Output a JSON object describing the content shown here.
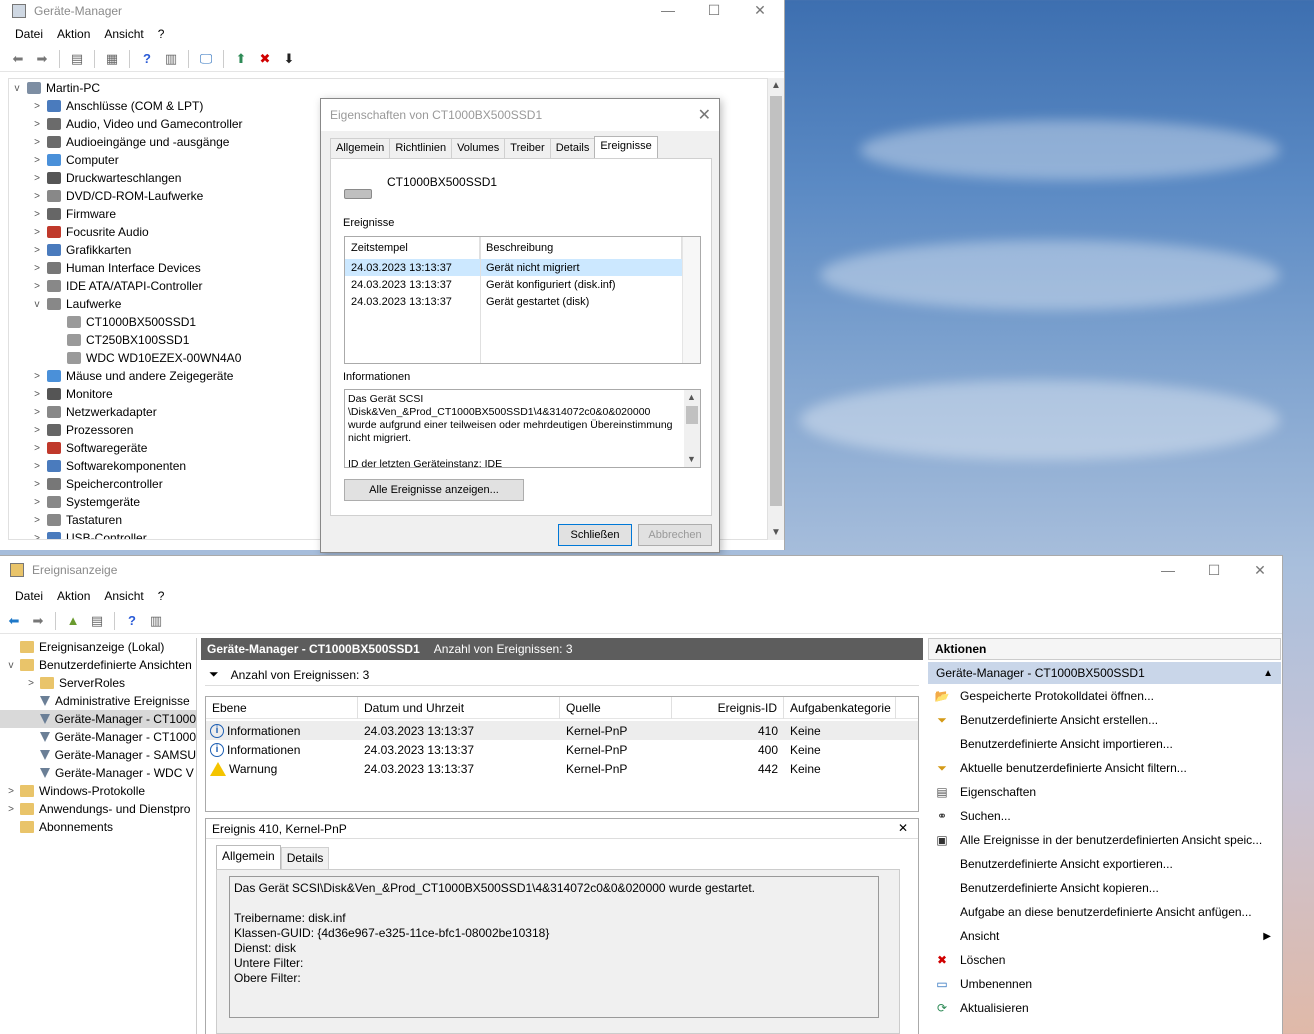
{
  "device_manager": {
    "title": "Geräte-Manager",
    "menu": [
      "Datei",
      "Aktion",
      "Ansicht",
      "?"
    ],
    "tree_root": "Martin-PC",
    "tree_items": [
      "Anschlüsse (COM & LPT)",
      "Audio, Video und Gamecontroller",
      "Audioeingänge und -ausgänge",
      "Computer",
      "Druckwarteschlangen",
      "DVD/CD-ROM-Laufwerke",
      "Firmware",
      "Focusrite Audio",
      "Grafikkarten",
      "Human Interface Devices",
      "IDE ATA/ATAPI-Controller",
      "Laufwerke"
    ],
    "drives": [
      "CT1000BX500SSD1",
      "CT250BX100SSD1",
      "WDC WD10EZEX-00WN4A0"
    ],
    "tree_items_after": [
      "Mäuse und andere Zeigegeräte",
      "Monitore",
      "Netzwerkadapter",
      "Prozessoren",
      "Softwaregeräte",
      "Softwarekomponenten",
      "Speichercontroller",
      "Systemgeräte",
      "Tastaturen",
      "USB-Controller"
    ]
  },
  "properties_dialog": {
    "title": "Eigenschaften von CT1000BX500SSD1",
    "tabs": [
      "Allgemein",
      "Richtlinien",
      "Volumes",
      "Treiber",
      "Details",
      "Ereignisse"
    ],
    "device_name": "CT1000BX500SSD1",
    "events_label": "Ereignisse",
    "col_timestamp": "Zeitstempel",
    "col_description": "Beschreibung",
    "events": [
      {
        "time": "24.03.2023 13:13:37",
        "desc": "Gerät nicht migriert"
      },
      {
        "time": "24.03.2023 13:13:37",
        "desc": "Gerät konfiguriert (disk.inf)"
      },
      {
        "time": "24.03.2023 13:13:37",
        "desc": "Gerät gestartet (disk)"
      }
    ],
    "info_label": "Informationen",
    "info_text_1": "Das Gerät SCSI",
    "info_text_2": "\\Disk&Ven_&Prod_CT1000BX500SSD1\\4&314072c0&0&020000",
    "info_text_3": "wurde aufgrund einer teilweisen oder mehrdeutigen Übereinstimmung",
    "info_text_4": "nicht migriert.",
    "info_text_5": "ID der letzten Geräteinstanz: IDE",
    "show_all_button": "Alle Ereignisse anzeigen...",
    "close_button": "Schließen",
    "cancel_button": "Abbrechen"
  },
  "event_viewer": {
    "title": "Ereignisanzeige",
    "menu": [
      "Datei",
      "Aktion",
      "Ansicht",
      "?"
    ],
    "tree": [
      {
        "label": "Ereignisanzeige (Lokal)",
        "level": 0,
        "exp": ""
      },
      {
        "label": "Benutzerdefinierte Ansichten",
        "level": 0,
        "exp": "v"
      },
      {
        "label": "ServerRoles",
        "level": 1,
        "exp": ">"
      },
      {
        "label": "Administrative Ereignisse",
        "level": 1,
        "exp": ""
      },
      {
        "label": "Geräte-Manager - CT1000",
        "level": 1,
        "exp": ""
      },
      {
        "label": "Geräte-Manager - CT1000",
        "level": 1,
        "exp": ""
      },
      {
        "label": "Geräte-Manager - SAMSU",
        "level": 1,
        "exp": ""
      },
      {
        "label": "Geräte-Manager - WDC V",
        "level": 1,
        "exp": ""
      },
      {
        "label": "Windows-Protokolle",
        "level": 0,
        "exp": ">"
      },
      {
        "label": "Anwendungs- und Dienstpro",
        "level": 0,
        "exp": ">"
      },
      {
        "label": "Abonnements",
        "level": 0,
        "exp": ""
      }
    ],
    "center_title": "Geräte-Manager - CT1000BX500SSD1",
    "center_count": "Anzahl von Ereignissen: 3",
    "count_bar": "Anzahl von Ereignissen: 3",
    "columns": [
      "Ebene",
      "Datum und Uhrzeit",
      "Quelle",
      "Ereignis-ID",
      "Aufgabenkategorie"
    ],
    "rows": [
      {
        "level": "Informationen",
        "date": "24.03.2023 13:13:37",
        "source": "Kernel-PnP",
        "id": "410",
        "cat": "Keine",
        "kind": "info"
      },
      {
        "level": "Informationen",
        "date": "24.03.2023 13:13:37",
        "source": "Kernel-PnP",
        "id": "400",
        "cat": "Keine",
        "kind": "info"
      },
      {
        "level": "Warnung",
        "date": "24.03.2023 13:13:37",
        "source": "Kernel-PnP",
        "id": "442",
        "cat": "Keine",
        "kind": "warn"
      }
    ],
    "detail_title": "Ereignis 410, Kernel-PnP",
    "detail_tabs": [
      "Allgemein",
      "Details"
    ],
    "detail_lines": [
      "Das Gerät SCSI\\Disk&Ven_&Prod_CT1000BX500SSD1\\4&314072c0&0&020000 wurde gestartet.",
      "",
      "Treibername: disk.inf",
      "Klassen-GUID: {4d36e967-e325-11ce-bfc1-08002be10318}",
      "Dienst: disk",
      "Untere Filter:",
      "Obere Filter:"
    ],
    "actions_title": "Aktionen",
    "actions_sub": "Geräte-Manager - CT1000BX500SSD1",
    "actions": [
      {
        "label": "Gespeicherte Protokolldatei öffnen...",
        "icon": "folder-icon"
      },
      {
        "label": "Benutzerdefinierte Ansicht erstellen...",
        "icon": "filter-icon"
      },
      {
        "label": "Benutzerdefinierte Ansicht importieren...",
        "icon": ""
      },
      {
        "label": "Aktuelle benutzerdefinierte Ansicht filtern...",
        "icon": "filter-icon"
      },
      {
        "label": "Eigenschaften",
        "icon": "properties-icon"
      },
      {
        "label": "Suchen...",
        "icon": "binoculars-icon"
      },
      {
        "label": "Alle Ereignisse in der benutzerdefinierten Ansicht speic...",
        "icon": "save-icon"
      },
      {
        "label": "Benutzerdefinierte Ansicht exportieren...",
        "icon": ""
      },
      {
        "label": "Benutzerdefinierte Ansicht kopieren...",
        "icon": ""
      },
      {
        "label": "Aufgabe an diese benutzerdefinierte Ansicht anfügen...",
        "icon": ""
      },
      {
        "label": "Ansicht",
        "icon": "",
        "submenu": true
      },
      {
        "label": "Löschen",
        "icon": "delete-icon"
      },
      {
        "label": "Umbenennen",
        "icon": "rename-icon"
      },
      {
        "label": "Aktualisieren",
        "icon": "refresh-icon"
      }
    ]
  },
  "colors": {
    "selected_row": "#cce8ff",
    "dark_header": "#5d5d5d",
    "action_subheader": "#c9d6e9",
    "delete_red": "#d00000"
  }
}
